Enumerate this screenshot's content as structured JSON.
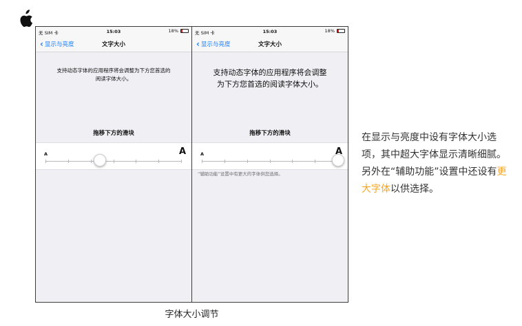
{
  "brand": {
    "logo_icon": "apple-logo-icon"
  },
  "status_bar": {
    "carrier": "无 SIM 卡",
    "time": "15:03",
    "battery": "18%"
  },
  "screens": [
    {
      "nav_back": "显示与亮度",
      "nav_title": "文字大小",
      "description": "支持动态字体的应用程序将会调整为下方您首选的阅读字体大小。",
      "drag_label": "拖移下方的滑块",
      "slider_small": "A",
      "slider_large": "A",
      "slider_level": 0.4,
      "note": ""
    },
    {
      "nav_back": "显示与亮度",
      "nav_title": "文字大小",
      "description": "支持动态字体的应用程序将会调整为下方您首选的阅读字体大小。",
      "drag_label": "拖移下方的滑块",
      "slider_small": "A",
      "slider_large": "A",
      "slider_level": 1.0,
      "note": "“辅助功能”设置中有更大的字体供您选择。"
    }
  ],
  "caption": "字体大小调节",
  "side_text": {
    "part1": "在显示与亮度中设有字体大小选项，其中超大字体显示清晰细腻。另外在“辅助功能”设置中还设有",
    "highlight": "更大字体",
    "part2": "以供选择。"
  },
  "colors": {
    "accent": "#1a7cf5",
    "highlight": "#f5a623",
    "battery_low": "#e02020"
  }
}
